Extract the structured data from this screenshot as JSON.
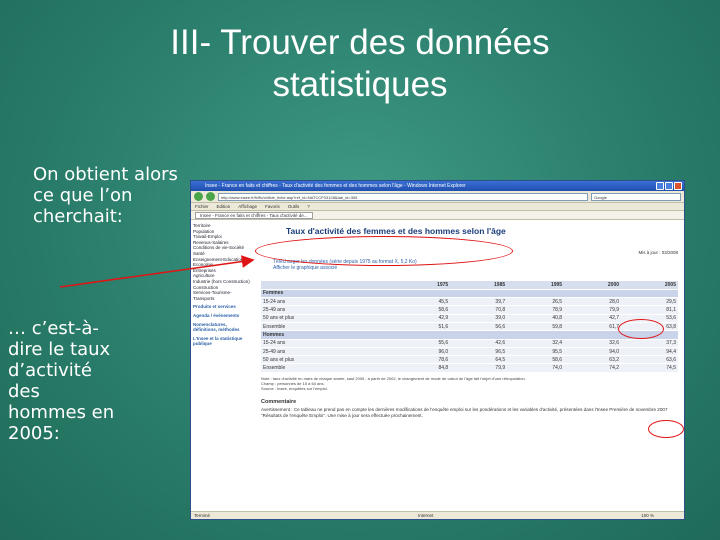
{
  "slide": {
    "title_line1": "III- Trouver des données",
    "title_line2": "statistiques",
    "intro": "On obtient alors ce que l’on cherchait:",
    "explanation": "… c’est-à-dire le taux d’activité des hommes en 2005:"
  },
  "browser": {
    "window_title": "Insee - France en faits et chiffres - Taux d'activité des femmes et des hommes selon l'âge - Windows Internet Explorer",
    "address": "http://www.insee.fr/fr/ffc/chifcle_fiche.asp?ref_id=NATCCF03128&tab_id=305",
    "search_placeholder": "Google",
    "menu": [
      "Fichier",
      "Edition",
      "Affichage",
      "Favoris",
      "Outils",
      "?"
    ],
    "tab_label": "Insee - France en faits et chiffres - Taux d'activité de...",
    "status_left": "Terminé",
    "status_right": "Internet",
    "zoom": "100 %"
  },
  "sidebar": {
    "items": [
      "Territoire",
      "Population",
      "Travail-Emploi",
      "Revenus-Salaires",
      "Conditions de vie-Société",
      "Santé",
      "Enseignement-Education",
      "Economie",
      "Entreprises",
      "Agriculture",
      "Industrie (hors Construction)",
      "Construction",
      "Services-Tourisme-Transports"
    ],
    "heads": [
      "Produits et services",
      "Agenda / événements",
      "Nomenclatures, définitions, méthodes",
      "L'Insee et la statistique publique"
    ]
  },
  "page": {
    "heading": "Taux d'activité des femmes et des hommes selon l'âge",
    "update": "Mis à jour : 03/2008",
    "download": "Télécharger les données (série depuis 1975 au format X, 5,2 Ko)",
    "chart_link": "Afficher le graphique associé",
    "columns": [
      "",
      "1975",
      "1985",
      "1995",
      "2000",
      "2005"
    ],
    "groups": [
      {
        "label": "Femmes",
        "rows": [
          [
            "15-24 ans",
            "45,5",
            "39,7",
            "26,5",
            "28,0",
            "29,5"
          ],
          [
            "25-49 ans",
            "58,6",
            "70,8",
            "78,9",
            "79,9",
            "81,1"
          ],
          [
            "50 ans et plus",
            "42,9",
            "39,0",
            "40,8",
            "42,7",
            "53,6"
          ],
          [
            "Ensemble",
            "51,6",
            "56,6",
            "59,8",
            "61,7",
            "63,8"
          ]
        ]
      },
      {
        "label": "Hommes",
        "rows": [
          [
            "15-24 ans",
            "55,6",
            "42,6",
            "32,4",
            "32,6",
            "37,3"
          ],
          [
            "25-49 ans",
            "96,0",
            "96,5",
            "95,5",
            "94,0",
            "94,4"
          ],
          [
            "50 ans et plus",
            "78,6",
            "64,5",
            "58,6",
            "63,2",
            "63,6"
          ],
          [
            "Ensemble",
            "84,8",
            "79,9",
            "74,0",
            "74,2",
            "74,5"
          ]
        ]
      }
    ],
    "notes": "Note : taux d'activité en mars de chaque année, sauf 2005 ; à partir de 2002, le changement de mode de calcul de l'âge fait l'objet d'une rétropolation.",
    "scope": "Champ : personnes de 15 à 64 ans.",
    "source": "Source : Insee, enquêtes sur l'emploi.",
    "comment_title": "Commentaire",
    "comment": "Avertissement : Ce tableau ne prend pas en compte les dernières modifications de l'enquête emploi sur les pondérations et les variables d'activité, présentées dans l'Insee Première de novembre 2007 \"Résultats de l'enquête Emploi\". Une mise à jour sera effectuée prochainement."
  },
  "colors": {
    "background": "#2a7e6b",
    "annotation": "#e01414",
    "link": "#2b5fa8"
  }
}
